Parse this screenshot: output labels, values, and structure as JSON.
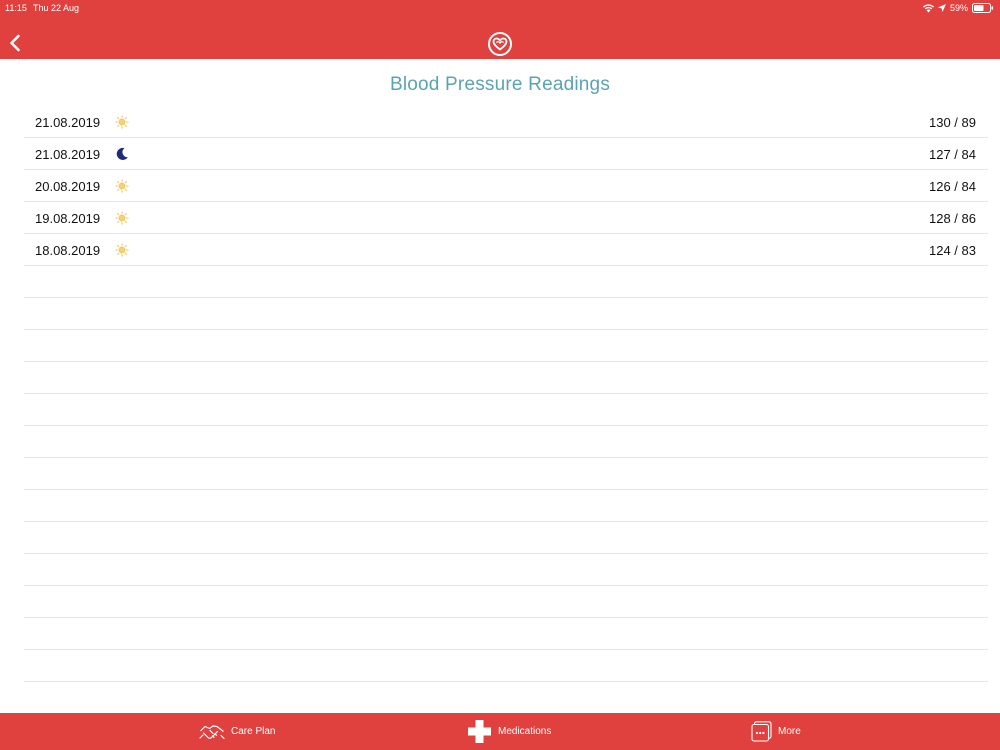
{
  "status_bar": {
    "time": "11:15",
    "date": "Thu 22 Aug",
    "battery": "59%"
  },
  "header": {
    "back_icon": "chevron-left-icon",
    "logo_icon": "heart-logo-icon"
  },
  "title": "Blood Pressure Readings",
  "readings": [
    {
      "date": "21.08.2019",
      "time_of_day": "sun-icon",
      "value": "130 / 89"
    },
    {
      "date": "21.08.2019",
      "time_of_day": "moon-icon",
      "value": "127 / 84"
    },
    {
      "date": "20.08.2019",
      "time_of_day": "sun-icon",
      "value": "126 / 84"
    },
    {
      "date": "19.08.2019",
      "time_of_day": "sun-icon",
      "value": "128 / 86"
    },
    {
      "date": "18.08.2019",
      "time_of_day": "sun-icon",
      "value": "124 / 83"
    }
  ],
  "tabbar": {
    "care_plan": "Care Plan",
    "medications": "Medications",
    "more": "More"
  },
  "colors": {
    "brand": "#e0413f",
    "title": "#5aa3b3",
    "sun": "#f2c14e",
    "moon": "#1f2a7a"
  }
}
